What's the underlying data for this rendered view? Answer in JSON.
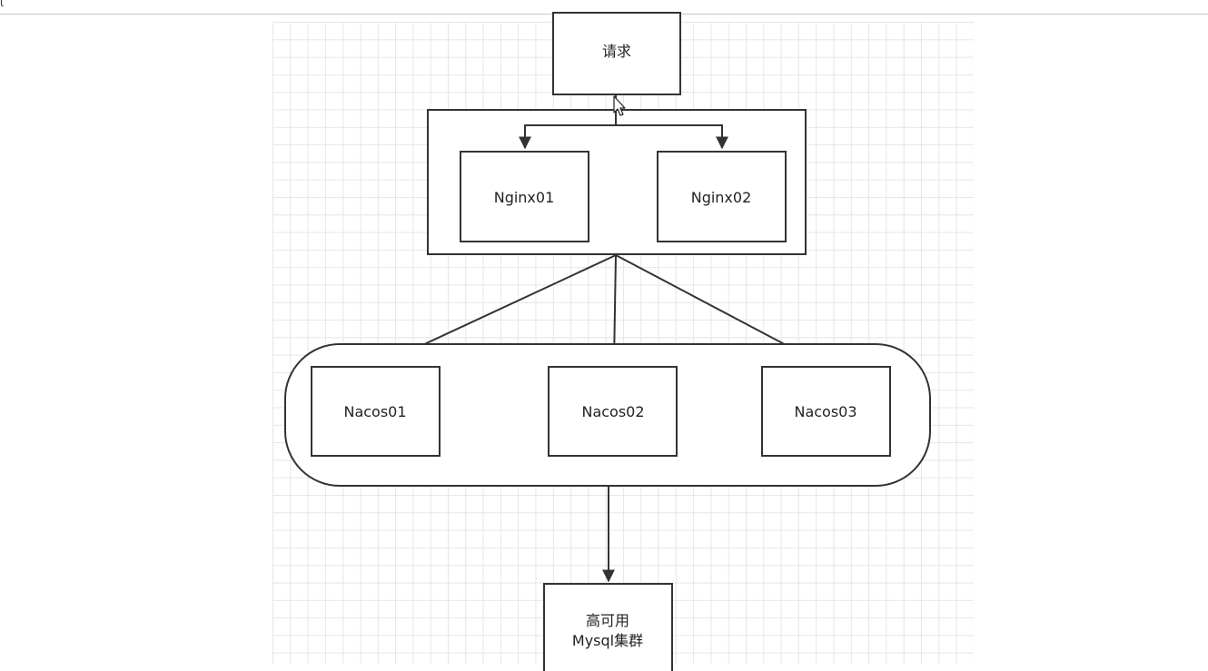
{
  "toolbar": {
    "glyph": "ι"
  },
  "diagram": {
    "request": "请求",
    "nginx": [
      "Nginx01",
      "Nginx02"
    ],
    "nacos": [
      "Nacos01",
      "Nacos02",
      "Nacos03"
    ],
    "mysql": {
      "line1": "高可用",
      "line2": "Mysql集群"
    }
  },
  "colors": {
    "stroke": "#333333",
    "grid": "#e6e6e6"
  },
  "icons": {
    "cursor": "hand-pointer-icon"
  }
}
